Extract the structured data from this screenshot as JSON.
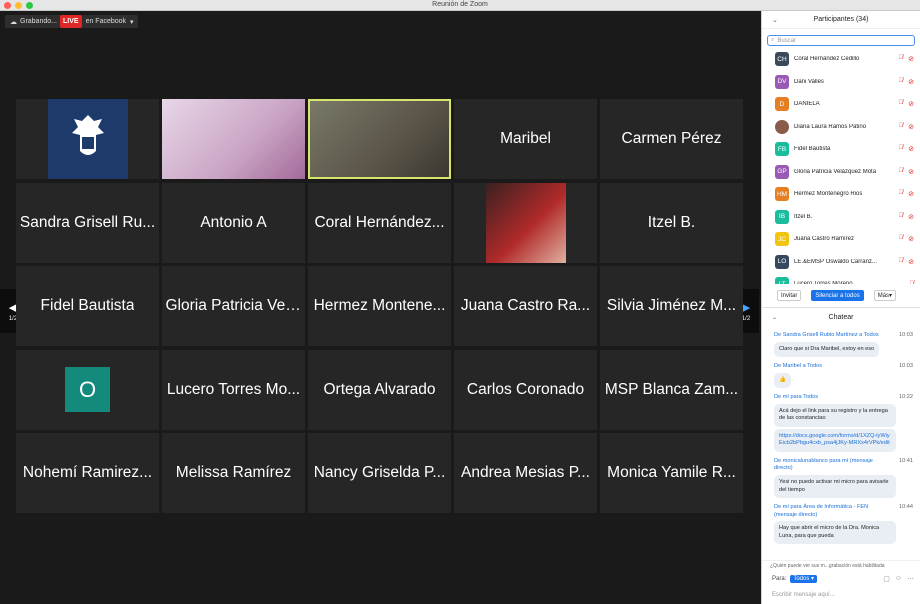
{
  "window": {
    "title": "Reunión de Zoom"
  },
  "top_bar": {
    "recording_label": "Grabando...",
    "live_badge": "LIVE",
    "live_label": "en Facebook"
  },
  "gallery": {
    "page_indicator_left": "1/2",
    "page_indicator_right": "1/2",
    "tiles": [
      {
        "name": "",
        "type": "logo"
      },
      {
        "name": "",
        "type": "video"
      },
      {
        "name": "",
        "type": "video-active"
      },
      {
        "name": "Maribel",
        "type": "name"
      },
      {
        "name": "Carmen Pérez",
        "type": "name"
      },
      {
        "name": "Sandra Grisell Ru...",
        "type": "name"
      },
      {
        "name": "Antonio A",
        "type": "name"
      },
      {
        "name": "Coral Hernández...",
        "type": "name"
      },
      {
        "name": "",
        "type": "photo"
      },
      {
        "name": "Itzel B.",
        "type": "name"
      },
      {
        "name": "Fidel Bautista",
        "type": "name"
      },
      {
        "name": "Gloria Patricia Vel...",
        "type": "name"
      },
      {
        "name": "Hermez Montene...",
        "type": "name"
      },
      {
        "name": "Juana Castro Ra...",
        "type": "name"
      },
      {
        "name": "Silvia Jiménez M...",
        "type": "name"
      },
      {
        "name": "O",
        "type": "initial"
      },
      {
        "name": "Lucero Torres Mo...",
        "type": "name"
      },
      {
        "name": "Ortega Alvarado",
        "type": "name"
      },
      {
        "name": "Carlos Coronado",
        "type": "name"
      },
      {
        "name": "MSP Blanca Zam...",
        "type": "name"
      },
      {
        "name": "Nohemí Ramirez...",
        "type": "name"
      },
      {
        "name": "Melissa Ramírez",
        "type": "name"
      },
      {
        "name": "Nancy Griselda P...",
        "type": "name"
      },
      {
        "name": "Andrea Mesias P...",
        "type": "name"
      },
      {
        "name": "Monica Yamile R...",
        "type": "name"
      }
    ]
  },
  "participants": {
    "title": "Participantes (34)",
    "search_placeholder": "Buscar",
    "list": [
      {
        "initials": "CH",
        "name": "Coral Hernández Cedillo",
        "color": "#3b4a5a"
      },
      {
        "initials": "DV",
        "name": "Dani Valles",
        "color": "#9b59b6"
      },
      {
        "initials": "D",
        "name": "DANIELA",
        "color": "#e67e22"
      },
      {
        "initials": "",
        "name": "Diana Laura Ramos Patiño",
        "color": "#8a5a4a"
      },
      {
        "initials": "FB",
        "name": "Fidel Bautista",
        "color": "#1abc9c"
      },
      {
        "initials": "GP",
        "name": "Gloria Patricia Velázquez Mota",
        "color": "#9b59b6"
      },
      {
        "initials": "HM",
        "name": "Hermez Montenegro Rios",
        "color": "#e67e22"
      },
      {
        "initials": "IB",
        "name": "Itzel B.",
        "color": "#1abc9c"
      },
      {
        "initials": "JC",
        "name": "Juana Castro Ramírez",
        "color": "#f1c40f"
      },
      {
        "initials": "LO",
        "name": "LE.&EMSP Oswaldo Carranz...",
        "color": "#34495e"
      },
      {
        "initials": "LT",
        "name": "Lucero Torres Moreno",
        "color": "#1abc9c"
      }
    ],
    "invite_label": "Invitar",
    "mute_all_label": "Silenciar a todos",
    "more_label": "Más"
  },
  "chat": {
    "title": "Chatear",
    "messages": [
      {
        "from": "De Sandra Grisell Rubio Martínez a Todos",
        "time": "10:03",
        "text": "Claro que si Dra Maribel, estoy en eso"
      },
      {
        "from": "De Maribel a Todos",
        "time": "10:03",
        "text": "👍"
      },
      {
        "from": "De mí para Todos",
        "time": "10:22",
        "text": "Acá dejo el link para su registro y la entrega de las constancias:",
        "link": "https://docs.google.com/forms/d/1XZQ-lyWiyEicb2bPbgu4cxb_psa4jJKy-MRXx4rVPk/edit"
      },
      {
        "from": "De monicalunablanco para mí (mensaje directo)",
        "time": "10:41",
        "text": "Yesi no puedo activar mi micro para avisarle del tiempo"
      },
      {
        "from": "De mí para Área de Informática - FEN (mensaje directo)",
        "time": "10:44",
        "text": "Hay que abrir el micro de la Dra. Monica Luna, para que pueda"
      }
    ],
    "notice": "¿Quién puede ver sus m...grabación está habilitada",
    "to_label": "Para:",
    "to_value": "Todos",
    "input_placeholder": "Escribir mensaje aquí..."
  }
}
